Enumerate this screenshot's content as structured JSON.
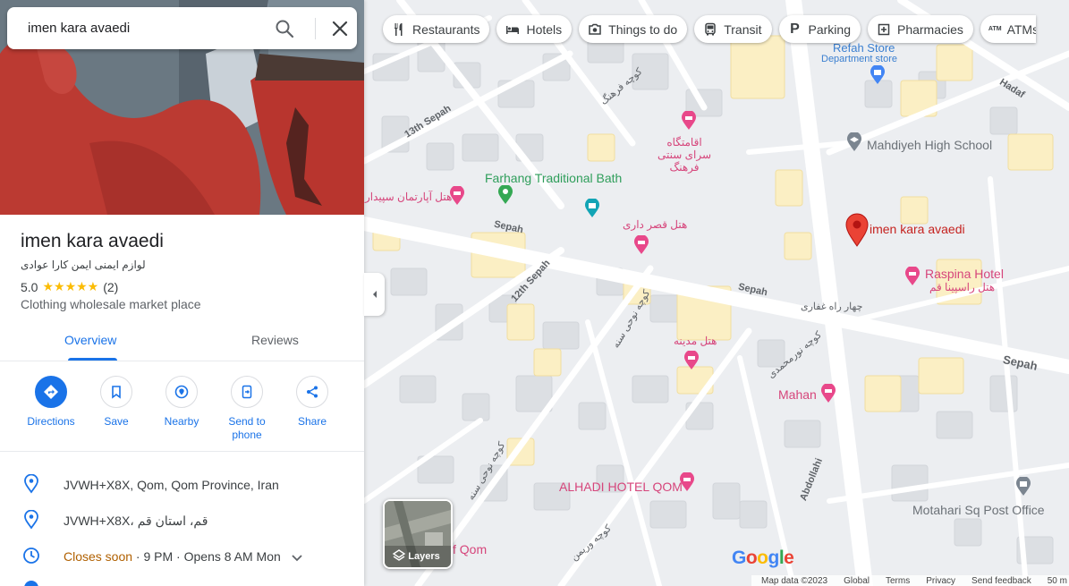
{
  "search": {
    "value": "imen kara avaedi"
  },
  "chips": [
    {
      "label": "Restaurants",
      "icon": "fork-knife-icon"
    },
    {
      "label": "Hotels",
      "icon": "bed-icon"
    },
    {
      "label": "Things to do",
      "icon": "camera-icon"
    },
    {
      "label": "Transit",
      "icon": "bus-icon"
    },
    {
      "label": "Parking",
      "icon": "parking-icon"
    },
    {
      "label": "Pharmacies",
      "icon": "pharmacy-icon"
    },
    {
      "label": "ATMs",
      "icon": "atm-icon"
    }
  ],
  "place": {
    "title": "imen kara avaedi",
    "subtitle": "لوازم ایمنی ایمن کارا عوادی",
    "rating": "5.0",
    "stars": "★★★★★",
    "review_count": "(2)",
    "category": "Clothing wholesale market place"
  },
  "tabs": [
    {
      "label": "Overview"
    },
    {
      "label": "Reviews"
    }
  ],
  "actions": [
    {
      "label": "Directions",
      "icon": "directions-icon"
    },
    {
      "label": "Save",
      "icon": "bookmark-icon"
    },
    {
      "label": "Nearby",
      "icon": "nearby-icon"
    },
    {
      "label": "Send to phone",
      "icon": "send-to-phone-icon"
    },
    {
      "label": "Share",
      "icon": "share-icon"
    }
  ],
  "info": {
    "address": "JVWH+X8X, Qom, Qom Province, Iran",
    "address_local": "JVWH+X8X، قم، استان قم",
    "hours_status": "Closes soon",
    "hours_detail": " · 9 PM · Opens 8 AM Mon"
  },
  "map": {
    "labels": {
      "refah": "Refah Store",
      "refah_sub": "Department store",
      "mahdiyeh": "Mahdiyeh High School",
      "farhang_bath": "Farhang Traditional Bath",
      "hotel_sepidar": "هتل آپارتمان سپیدار",
      "hotel_farhang": "اقامتگاه سرای سنتی فرهنگ",
      "hotel_darri": "هتل قصر داری",
      "imen": "imen kara avaedi",
      "raspina": "Raspina Hotel",
      "raspina_fa": "هتل راسپینا قم",
      "hotel_medina": "هتل مدینه",
      "mahan": "Mahan",
      "alhadi": "ALHADI HOTEL QOM",
      "motahari": "Motahari Sq Post Office",
      "f_qom": "f Qom"
    },
    "roads": {
      "sepah_1": "Sepah",
      "sepah_2": "Sepah",
      "sepah_3": "Sepah",
      "thirteen_sepah": "13th Sepah",
      "twelve_sepah": "12th Sepah",
      "hadaf": "Hadaf",
      "abdollahi": "Abdollahi",
      "ghaffari": "چهار راه غفاری",
      "alley_1": "کوچه فرهنگ",
      "alley_2": "کوچه نوحی سنه",
      "alley_3": "کوچه نوحی سنه",
      "alley_4": "کوچه نورمحمدی",
      "alley_5": "کوچه وریمن"
    },
    "layers_label": "Layers",
    "google": "Google",
    "footer": {
      "map_data": "Map data ©2023",
      "global": "Global",
      "terms": "Terms",
      "privacy": "Privacy",
      "feedback": "Send feedback",
      "scale": "50 m"
    }
  },
  "colors": {
    "accent": "#1a73e8",
    "star": "#fbbc04",
    "pin": "#ea4335",
    "hotel_pink": "#d6457b",
    "closes_soon": "#b06000"
  }
}
